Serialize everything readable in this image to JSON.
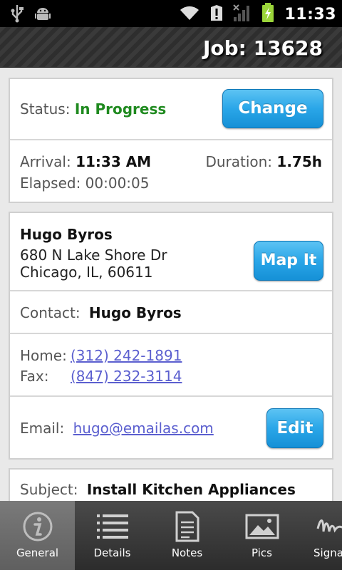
{
  "status_bar": {
    "time": "11:33",
    "icons": [
      "usb-icon",
      "android-debug-icon",
      "wifi-icon",
      "alert-icon",
      "signal-icon",
      "battery-charging-icon"
    ]
  },
  "header": {
    "title": "Job: 13628"
  },
  "status_card": {
    "status_label": "Status:",
    "status_value": "In Progress",
    "change_button": "Change",
    "arrival_label": "Arrival:",
    "arrival_value": "11:33 AM",
    "duration_label": "Duration:",
    "duration_value": "1.75h",
    "elapsed_label": "Elapsed:",
    "elapsed_value": "00:00:05"
  },
  "customer_card": {
    "name": "Hugo Byros",
    "address_line1": "680 N Lake Shore Dr",
    "address_line2": "Chicago, IL, 60611",
    "map_button": "Map It",
    "contact_label": "Contact:",
    "contact_value": "Hugo Byros",
    "home_label": "Home:",
    "home_value": "(312) 242-1891",
    "fax_label": "Fax:",
    "fax_value": "(847) 232-3114",
    "email_label": "Email:",
    "email_value": "hugo@emailas.com",
    "edit_button": "Edit"
  },
  "subject_card": {
    "subject_label": "Subject:",
    "subject_value": "Install Kitchen Appliances"
  },
  "tabs": [
    {
      "label": "General",
      "icon": "info-icon",
      "active": true
    },
    {
      "label": "Details",
      "icon": "list-icon",
      "active": false
    },
    {
      "label": "Notes",
      "icon": "document-icon",
      "active": false
    },
    {
      "label": "Pics",
      "icon": "picture-icon",
      "active": false
    },
    {
      "label": "Signa",
      "icon": "signature-icon",
      "active": false
    }
  ],
  "colors": {
    "accent_button": "#2aa6e8",
    "status_green": "#1f8a1f",
    "link": "#5b5fcf"
  }
}
